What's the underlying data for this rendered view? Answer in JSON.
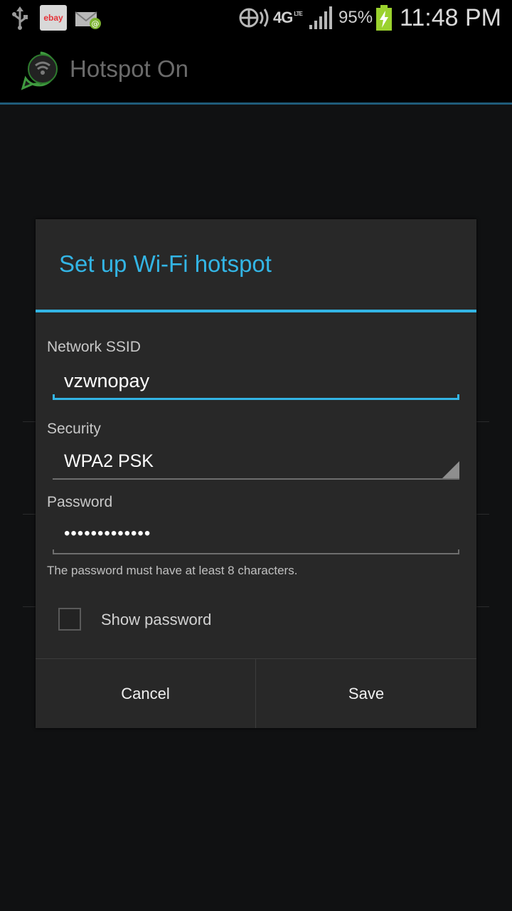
{
  "status_bar": {
    "ebay_label": "ebay",
    "network_type": "4G",
    "network_sub": "LTE",
    "battery_percent": "95%",
    "time": "11:48 PM"
  },
  "action_bar": {
    "title": "Hotspot On"
  },
  "dialog": {
    "title": "Set up Wi-Fi hotspot",
    "ssid_label": "Network SSID",
    "ssid_value": "vzwnopay",
    "security_label": "Security",
    "security_value": "WPA2 PSK",
    "password_label": "Password",
    "password_value": "•••••••••••••",
    "password_hint": "The password must have at least 8 characters.",
    "show_password_label": "Show password",
    "show_password_checked": false,
    "cancel_label": "Cancel",
    "save_label": "Save"
  },
  "colors": {
    "accent": "#33b5e5",
    "dialog_bg": "#282828",
    "app_bg": "#101112"
  },
  "icons": [
    "usb-icon",
    "ebay-icon",
    "email-icon",
    "sync-icon",
    "signal-icon",
    "battery-charging-icon",
    "hotspot-app-icon",
    "spinner-arrow-icon"
  ]
}
